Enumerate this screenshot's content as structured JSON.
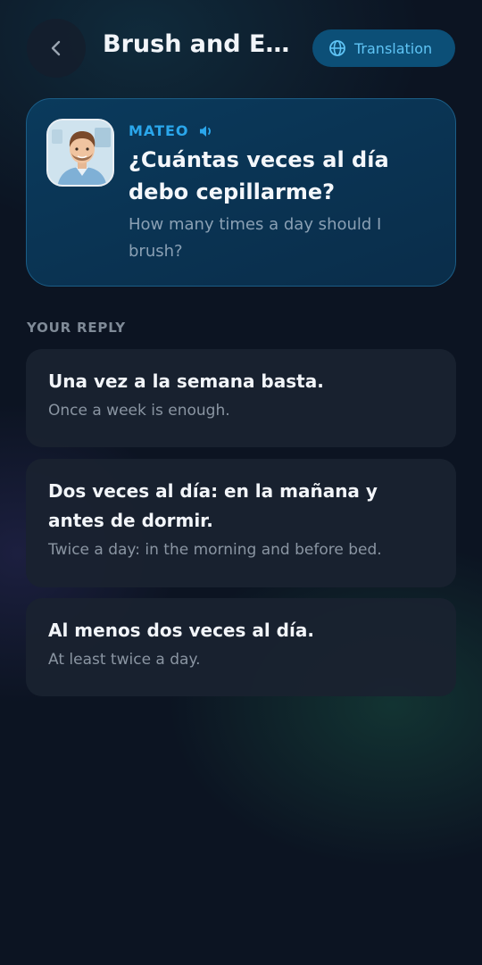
{
  "header": {
    "title": "Brush and Ea...",
    "back_icon": "chevron-left-icon",
    "translation_label": "Translation",
    "translation_icon": "globe-icon"
  },
  "prompt": {
    "speaker": "MATEO",
    "avatar_icon": "avatar-illustration",
    "audio_icon": "volume-icon",
    "spanish": "¿Cuántas veces al día debo cepillarme?",
    "english": "How many times a day should I brush?"
  },
  "replies_section": {
    "label": "YOUR REPLY",
    "options": [
      {
        "spanish": "Una vez a la semana basta.",
        "english": "Once a week is enough."
      },
      {
        "spanish": "Dos veces al día: en la mañana y antes de dormir.",
        "english": "Twice a day: in the morning and before bed."
      },
      {
        "spanish": "Al menos dos veces al día.",
        "english": "At least twice a day."
      }
    ]
  },
  "colors": {
    "background": "#0c1422",
    "accent": "#2aa7ec",
    "card": "#0a3a5c",
    "reply_card": "#1a2230"
  }
}
